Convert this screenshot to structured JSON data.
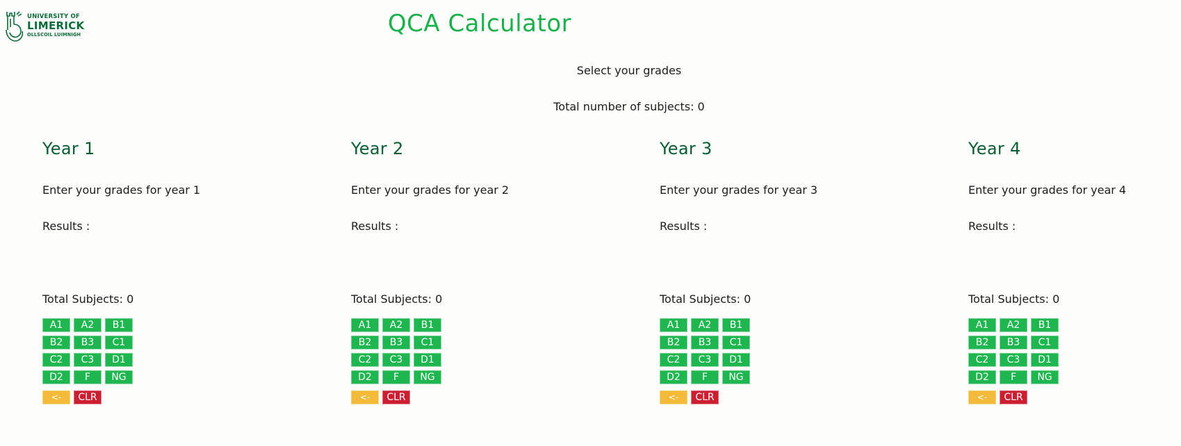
{
  "logo": {
    "line1": "UNIVERSITY OF",
    "line2": "LIMERICK",
    "line3": "OLLSCOIL LUIMNIGH"
  },
  "title": "QCA Calculator",
  "subtitle": "Select your grades",
  "total_subjects_all": "Total number of subjects: 0",
  "colors": {
    "title_green": "#1ab04b",
    "heading_green": "#0b5e33",
    "grade_button": "#1db64f",
    "back_button": "#f4bb3a",
    "clear_button": "#cc1f32"
  },
  "years": [
    {
      "heading": "Year 1",
      "enter_text": "Enter your grades for year 1",
      "results_label": "Results :",
      "results_value": "",
      "total_subjects": "Total Subjects: 0"
    },
    {
      "heading": "Year 2",
      "enter_text": "Enter your grades for year 2",
      "results_label": "Results :",
      "results_value": "",
      "total_subjects": "Total Subjects: 0"
    },
    {
      "heading": "Year 3",
      "enter_text": "Enter your grades for year 3",
      "results_label": "Results :",
      "results_value": "",
      "total_subjects": "Total Subjects: 0"
    },
    {
      "heading": "Year 4",
      "enter_text": "Enter your grades for year 4",
      "results_label": "Results :",
      "results_value": "",
      "total_subjects": "Total Subjects: 0"
    }
  ],
  "grades": [
    "A1",
    "A2",
    "B1",
    "B2",
    "B3",
    "C1",
    "C2",
    "C3",
    "D1",
    "D2",
    "F",
    "NG"
  ],
  "controls": {
    "back_label": "<-",
    "clear_label": "CLR"
  }
}
